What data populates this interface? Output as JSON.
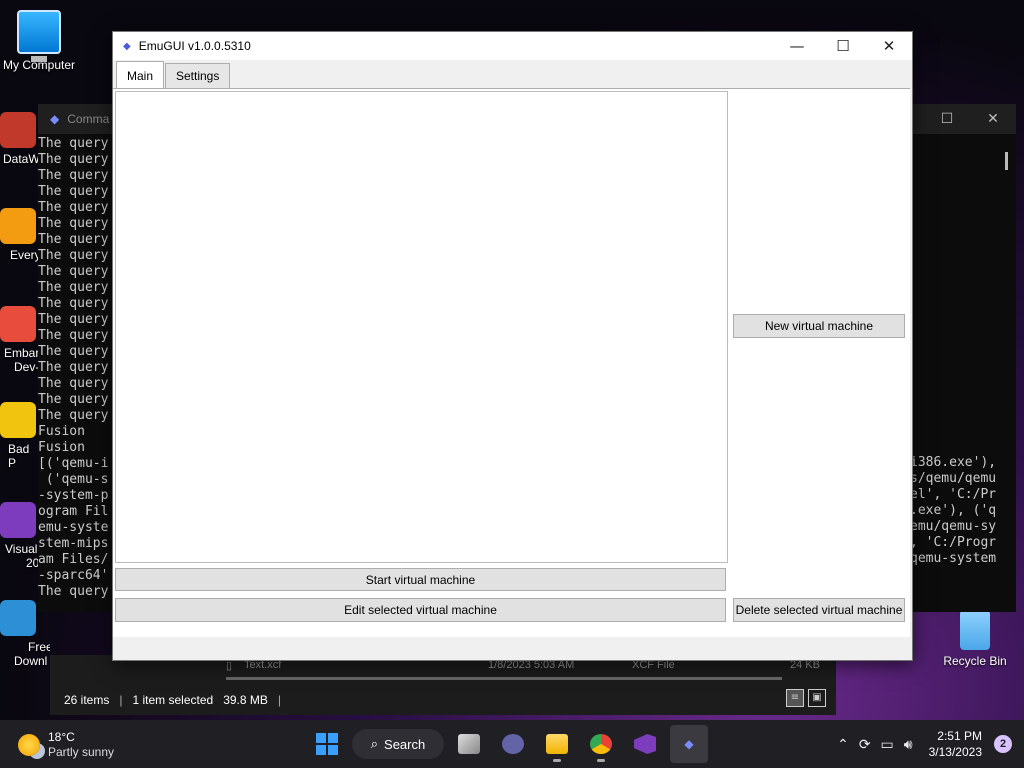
{
  "desktop": {
    "icons": {
      "my_computer": "My Computer",
      "recycle_bin": "Recycle Bin",
      "partial_1": "DataW",
      "partial_2": "Every",
      "partial_3a": "Embar",
      "partial_3b": "Dev-",
      "partial_4": "Bad P",
      "partial_5a": "Visual",
      "partial_5b": "20",
      "partial_6a": "Free",
      "partial_6b": "Downl"
    }
  },
  "cmd_window": {
    "title": "Comma",
    "left_lines": [
      "The query",
      "The query",
      "The query",
      "The query",
      "The query",
      "The query",
      "The query",
      "The query",
      "The query",
      "The query",
      "The query",
      "The query",
      "The query",
      "The query",
      "The query",
      "The query",
      "The query",
      "The query",
      "Fusion",
      "Fusion",
      "[('qemu-i",
      " ('qemu-s",
      "-system-p",
      "ogram Fil",
      "emu-syste",
      "stem-mips",
      "am Files/",
      "-sparc64'",
      "The query"
    ],
    "right_lines": [
      "i386.exe'),",
      "s/qemu/qemu",
      "el', 'C:/Pr",
      ".exe'), ('q",
      "emu/qemu-sy",
      ", 'C:/Progr",
      "qemu-system"
    ]
  },
  "explorer": {
    "row": {
      "name": "Text.xcf",
      "date": "1/8/2023 5:03 AM",
      "type": "XCF File",
      "size": "24 KB"
    },
    "status": {
      "items": "26 items",
      "selected": "1 item selected",
      "size": "39.8 MB"
    }
  },
  "emugui": {
    "title": "EmuGUI v1.0.0.5310",
    "tabs": [
      {
        "label": "Main",
        "active": true
      },
      {
        "label": "Settings",
        "active": false
      }
    ],
    "buttons": {
      "new_vm": "New virtual machine",
      "start_vm": "Start virtual machine",
      "edit_vm": "Edit selected virtual machine",
      "delete_vm": "Delete selected virtual machine"
    }
  },
  "taskbar": {
    "weather": {
      "temp": "18°C",
      "desc": "Partly sunny"
    },
    "search_label": "Search",
    "clock": {
      "time": "2:51 PM",
      "date": "3/13/2023"
    },
    "notifications": "2"
  },
  "colors": {
    "accent": "#0078d4",
    "active_app_indicator": "#e48cff"
  }
}
